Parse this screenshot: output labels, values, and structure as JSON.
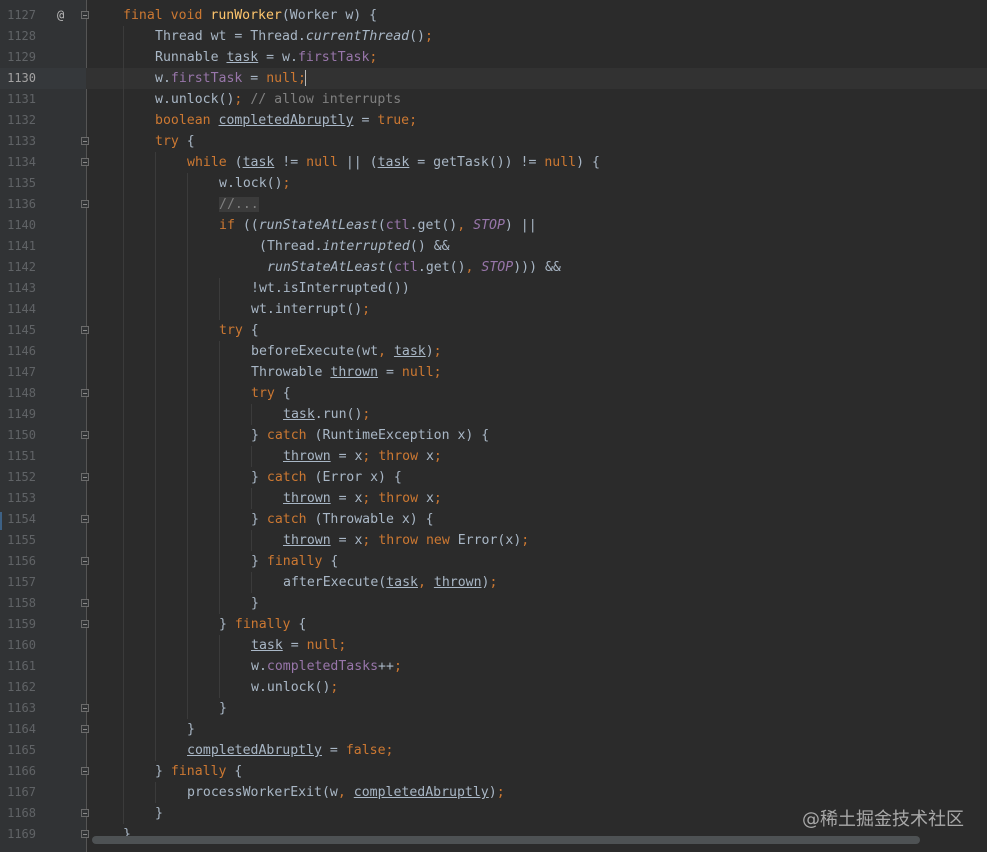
{
  "watermark": "@稀土掘金技术社区",
  "gutter": {
    "override_marker": "@",
    "current_line": "1130"
  },
  "lines": [
    {
      "n": "1127",
      "indent": 0,
      "fold": true,
      "ann": "@",
      "t": [
        [
          "final",
          "kw"
        ],
        [
          " "
        ],
        [
          "void",
          "kw"
        ],
        [
          " "
        ],
        [
          "runWorker",
          "m"
        ],
        [
          "(Worker w) {"
        ]
      ]
    },
    {
      "n": "1128",
      "indent": 1,
      "t": [
        [
          "Thread wt = Thread."
        ],
        [
          "currentThread",
          "it"
        ],
        [
          "()"
        ],
        [
          ";",
          "kw"
        ]
      ]
    },
    {
      "n": "1129",
      "indent": 1,
      "t": [
        [
          "Runnable "
        ],
        [
          "task",
          "u"
        ],
        [
          " = w."
        ],
        [
          "firstTask",
          "f"
        ],
        [
          ";",
          "kw"
        ]
      ]
    },
    {
      "n": "1130",
      "indent": 1,
      "caret": true,
      "t": [
        [
          "w."
        ],
        [
          "firstTask",
          "f"
        ],
        [
          " = "
        ],
        [
          "null",
          "kw"
        ],
        [
          ";",
          "kw"
        ]
      ]
    },
    {
      "n": "1131",
      "indent": 1,
      "t": [
        [
          "w.unlock()"
        ],
        [
          ";",
          "kw"
        ],
        [
          " "
        ],
        [
          "// allow interrupts",
          "cm"
        ]
      ]
    },
    {
      "n": "1132",
      "indent": 1,
      "t": [
        [
          "boolean",
          "kw"
        ],
        [
          " "
        ],
        [
          "completedAbruptly",
          "u"
        ],
        [
          " = "
        ],
        [
          "true",
          "kw"
        ],
        [
          ";",
          "kw"
        ]
      ]
    },
    {
      "n": "1133",
      "indent": 1,
      "fold": true,
      "t": [
        [
          "try",
          "kw"
        ],
        [
          " {"
        ]
      ]
    },
    {
      "n": "1134",
      "indent": 2,
      "fold": true,
      "t": [
        [
          "while",
          "kw"
        ],
        [
          " ("
        ],
        [
          "task",
          "u"
        ],
        [
          " != "
        ],
        [
          "null",
          "kw"
        ],
        [
          " || ("
        ],
        [
          "task",
          "u"
        ],
        [
          " = getTask()) != "
        ],
        [
          "null",
          "kw"
        ],
        [
          ") {"
        ]
      ]
    },
    {
      "n": "1135",
      "indent": 3,
      "t": [
        [
          "w.lock()"
        ],
        [
          ";",
          "kw"
        ]
      ]
    },
    {
      "n": "1136",
      "indent": 3,
      "fold": true,
      "t": [
        [
          "//...",
          "fc"
        ]
      ]
    },
    {
      "n": "1140",
      "indent": 3,
      "t": [
        [
          "if",
          "kw"
        ],
        [
          " (("
        ],
        [
          "runStateAtLeast",
          "it"
        ],
        [
          "("
        ],
        [
          "ctl",
          "f"
        ],
        [
          ".get()"
        ],
        [
          ",",
          "kw"
        ],
        [
          " "
        ],
        [
          "STOP",
          "cst"
        ],
        [
          ") ||"
        ]
      ]
    },
    {
      "n": "1141",
      "indent": 3,
      "pad": 5,
      "t": [
        [
          "(Thread."
        ],
        [
          "interrupted",
          "it"
        ],
        [
          "() &&"
        ]
      ]
    },
    {
      "n": "1142",
      "indent": 3,
      "pad": 6,
      "t": [
        [
          "runStateAtLeast",
          "it"
        ],
        [
          "("
        ],
        [
          "ctl",
          "f"
        ],
        [
          ".get()"
        ],
        [
          ",",
          "kw"
        ],
        [
          " "
        ],
        [
          "STOP",
          "cst"
        ],
        [
          "))) &&"
        ]
      ]
    },
    {
      "n": "1143",
      "indent": 4,
      "t": [
        [
          "!wt.isInterrupted())"
        ]
      ]
    },
    {
      "n": "1144",
      "indent": 4,
      "t": [
        [
          "wt.interrupt()"
        ],
        [
          ";",
          "kw"
        ]
      ]
    },
    {
      "n": "1145",
      "indent": 3,
      "fold": true,
      "t": [
        [
          "try",
          "kw"
        ],
        [
          " {"
        ]
      ]
    },
    {
      "n": "1146",
      "indent": 4,
      "t": [
        [
          "beforeExecute(wt"
        ],
        [
          ",",
          "kw"
        ],
        [
          " "
        ],
        [
          "task",
          "u"
        ],
        [
          ")"
        ],
        [
          ";",
          "kw"
        ]
      ]
    },
    {
      "n": "1147",
      "indent": 4,
      "t": [
        [
          "Throwable "
        ],
        [
          "thrown",
          "u"
        ],
        [
          " = "
        ],
        [
          "null",
          "kw"
        ],
        [
          ";",
          "kw"
        ]
      ]
    },
    {
      "n": "1148",
      "indent": 4,
      "fold": true,
      "t": [
        [
          "try",
          "kw"
        ],
        [
          " {"
        ]
      ]
    },
    {
      "n": "1149",
      "indent": 5,
      "t": [
        [
          "task",
          "u"
        ],
        [
          ".run()"
        ],
        [
          ";",
          "kw"
        ]
      ]
    },
    {
      "n": "1150",
      "indent": 4,
      "fold": true,
      "t": [
        [
          "} "
        ],
        [
          "catch",
          "kw"
        ],
        [
          " (RuntimeException x) {"
        ]
      ]
    },
    {
      "n": "1151",
      "indent": 5,
      "t": [
        [
          "thrown",
          "u"
        ],
        [
          " = x"
        ],
        [
          ";",
          "kw"
        ],
        [
          " "
        ],
        [
          "throw",
          "kw"
        ],
        [
          " x"
        ],
        [
          ";",
          "kw"
        ]
      ]
    },
    {
      "n": "1152",
      "indent": 4,
      "fold": true,
      "t": [
        [
          "} "
        ],
        [
          "catch",
          "kw"
        ],
        [
          " (Error x) {"
        ]
      ]
    },
    {
      "n": "1153",
      "indent": 5,
      "t": [
        [
          "thrown",
          "u"
        ],
        [
          " = x"
        ],
        [
          ";",
          "kw"
        ],
        [
          " "
        ],
        [
          "throw",
          "kw"
        ],
        [
          " x"
        ],
        [
          ";",
          "kw"
        ]
      ]
    },
    {
      "n": "1154",
      "indent": 4,
      "fold": true,
      "t": [
        [
          "} "
        ],
        [
          "catch",
          "kw"
        ],
        [
          " (Throwable x) {"
        ]
      ]
    },
    {
      "n": "1155",
      "indent": 5,
      "t": [
        [
          "thrown",
          "u"
        ],
        [
          " = x"
        ],
        [
          ";",
          "kw"
        ],
        [
          " "
        ],
        [
          "throw",
          "kw"
        ],
        [
          " "
        ],
        [
          "new",
          "kw"
        ],
        [
          " Error(x)"
        ],
        [
          ";",
          "kw"
        ]
      ]
    },
    {
      "n": "1156",
      "indent": 4,
      "fold": true,
      "t": [
        [
          "} "
        ],
        [
          "finally",
          "kw"
        ],
        [
          " {"
        ]
      ]
    },
    {
      "n": "1157",
      "indent": 5,
      "t": [
        [
          "afterExecute("
        ],
        [
          "task",
          "u"
        ],
        [
          ",",
          "kw"
        ],
        [
          " "
        ],
        [
          "thrown",
          "u"
        ],
        [
          ")"
        ],
        [
          ";",
          "kw"
        ]
      ]
    },
    {
      "n": "1158",
      "indent": 4,
      "fold": true,
      "t": [
        [
          "}"
        ]
      ]
    },
    {
      "n": "1159",
      "indent": 3,
      "fold": true,
      "t": [
        [
          "} "
        ],
        [
          "finally",
          "kw"
        ],
        [
          " {"
        ]
      ]
    },
    {
      "n": "1160",
      "indent": 4,
      "t": [
        [
          "task",
          "u"
        ],
        [
          " = "
        ],
        [
          "null",
          "kw"
        ],
        [
          ";",
          "kw"
        ]
      ]
    },
    {
      "n": "1161",
      "indent": 4,
      "t": [
        [
          "w."
        ],
        [
          "completedTasks",
          "f"
        ],
        [
          "++"
        ],
        [
          ";",
          "kw"
        ]
      ]
    },
    {
      "n": "1162",
      "indent": 4,
      "t": [
        [
          "w.unlock()"
        ],
        [
          ";",
          "kw"
        ]
      ]
    },
    {
      "n": "1163",
      "indent": 3,
      "fold": true,
      "t": [
        [
          "}"
        ]
      ]
    },
    {
      "n": "1164",
      "indent": 2,
      "fold": true,
      "t": [
        [
          "}"
        ]
      ]
    },
    {
      "n": "1165",
      "indent": 2,
      "t": [
        [
          "completedAbruptly",
          "u"
        ],
        [
          " = "
        ],
        [
          "false",
          "kw"
        ],
        [
          ";",
          "kw"
        ]
      ]
    },
    {
      "n": "1166",
      "indent": 1,
      "fold": true,
      "t": [
        [
          "} "
        ],
        [
          "finally",
          "kw"
        ],
        [
          " {"
        ]
      ]
    },
    {
      "n": "1167",
      "indent": 2,
      "t": [
        [
          "processWorkerExit(w"
        ],
        [
          ",",
          "kw"
        ],
        [
          " "
        ],
        [
          "completedAbruptly",
          "u"
        ],
        [
          ")"
        ],
        [
          ";",
          "kw"
        ]
      ]
    },
    {
      "n": "1168",
      "indent": 1,
      "fold": true,
      "t": [
        [
          "}"
        ]
      ]
    },
    {
      "n": "1169",
      "indent": 0,
      "fold": true,
      "t": [
        [
          "}"
        ]
      ]
    }
  ]
}
